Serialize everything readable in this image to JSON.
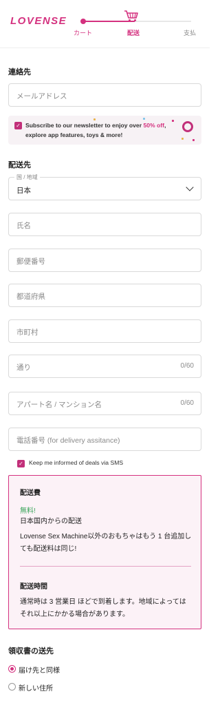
{
  "header": {
    "logo": "LOVENSE",
    "steps": [
      "カート",
      "配送",
      "支払"
    ]
  },
  "contact": {
    "title": "連絡先",
    "email_placeholder": "メールアドレス",
    "newsletter": {
      "text_before": "Subscribe to our newsletter to enjoy over ",
      "highlight": "50% off",
      "text_after": ", explore app features, toys & more!",
      "checked": true
    }
  },
  "shipping": {
    "title": "配送先",
    "country_label": "国 / 地域",
    "country_value": "日本",
    "name_placeholder": "氏名",
    "postal_placeholder": "郵便番号",
    "prefecture_placeholder": "都道府県",
    "city_placeholder": "市町村",
    "street_placeholder": "通り",
    "street_counter": "0/60",
    "building_placeholder": "アパート名 / マンション名",
    "building_counter": "0/60",
    "phone_placeholder": "電話番号 (for delivery assitance)",
    "sms_label": "Keep me informed of deals via SMS"
  },
  "info_box": {
    "fee_title": "配送費",
    "fee_free": "無料!",
    "fee_line1": "日本国内からの配送",
    "fee_line2": "Lovense Sex Machine以外のおもちゃはもう 1 台追加しても配送料は同じ!",
    "time_title": "配送時間",
    "time_text": "通常時は 3 営業日 ほどで到着します。地域によってはそれ以上にかかる場合があります。"
  },
  "receipt": {
    "title": "領収書の送先",
    "options": [
      "届け先と同様",
      "新しい住所"
    ]
  },
  "colors": {
    "accent": "#d4317f",
    "free_green": "#3aa55a",
    "box_bg": "#fcf2f7"
  }
}
